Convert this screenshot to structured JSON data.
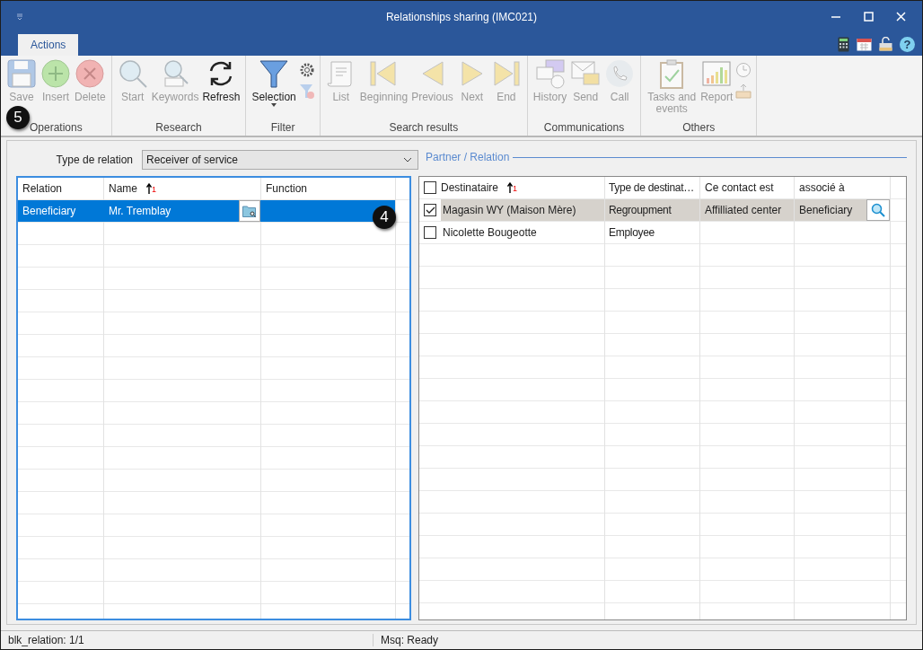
{
  "window": {
    "title": "Relationships sharing (IMC021)"
  },
  "tabs": [
    {
      "label": "Actions",
      "selected": true
    }
  ],
  "help_glyph": "?",
  "ribbon": [
    {
      "label": "Operations",
      "buttons": [
        {
          "kind": "large",
          "label": "Save",
          "disabled": true
        },
        {
          "kind": "large",
          "label": "Insert",
          "disabled": true
        },
        {
          "kind": "large",
          "label": "Delete",
          "disabled": true
        }
      ]
    },
    {
      "label": "Research",
      "buttons": [
        {
          "kind": "large",
          "label": "Start",
          "disabled": true
        },
        {
          "kind": "large",
          "label": "Keywords",
          "disabled": true
        },
        {
          "kind": "large",
          "label": "Refresh",
          "disabled": false
        }
      ]
    },
    {
      "label": "Filter",
      "buttons": [
        {
          "kind": "dropdown",
          "label": "Selection",
          "disabled": false
        },
        {
          "kind": "small",
          "disabled": false
        },
        {
          "kind": "small",
          "disabled": true
        }
      ]
    },
    {
      "label": "Search results",
      "buttons": [
        {
          "kind": "large",
          "label": "List",
          "disabled": true
        },
        {
          "kind": "large",
          "label": "Beginning",
          "disabled": true
        },
        {
          "kind": "large",
          "label": "Previous",
          "disabled": true
        },
        {
          "kind": "large",
          "label": "Next",
          "disabled": true
        },
        {
          "kind": "large",
          "label": "End",
          "disabled": true
        }
      ]
    },
    {
      "label": "Communications",
      "buttons": [
        {
          "kind": "large",
          "label": "History",
          "disabled": true
        },
        {
          "kind": "large",
          "label": "Send",
          "disabled": true
        },
        {
          "kind": "large",
          "label": "Call",
          "disabled": true
        }
      ]
    },
    {
      "label": "Others",
      "buttons": [
        {
          "kind": "large",
          "label": "Tasks and events",
          "disabled": true
        },
        {
          "kind": "large",
          "label": "Report",
          "disabled": true
        },
        {
          "kind": "small",
          "disabled": true
        },
        {
          "kind": "small",
          "disabled": true
        }
      ]
    }
  ],
  "relation_type": {
    "label": "Type de relation",
    "value": "Receiver of service"
  },
  "partner_section": {
    "title": "Partner / Relation"
  },
  "left_table": {
    "columns": [
      {
        "label": "Relation"
      },
      {
        "label": "Name",
        "sort": "1"
      },
      {
        "label": "Function"
      }
    ],
    "rows": [
      {
        "cells": [
          "Beneficiary",
          "Mr. Tremblay",
          ""
        ],
        "selected": true
      }
    ]
  },
  "right_table": {
    "header_checked": false,
    "columns": [
      {
        "label": "Destinataire",
        "sort": "1"
      },
      {
        "label": "Type de destinat…"
      },
      {
        "label": "Ce contact est"
      },
      {
        "label": "associé à"
      }
    ],
    "rows": [
      {
        "checked": true,
        "selected": true,
        "cells": [
          "Magasin WY (Maison Mère)",
          "Regroupment",
          "Affilliated center",
          "Beneficiary"
        ]
      },
      {
        "checked": false,
        "selected": false,
        "cells": [
          "Nicolette Bougeotte",
          "Employee",
          "",
          ""
        ]
      }
    ]
  },
  "status_bar": [
    "blk_relation: 1/1",
    "Msq: Ready"
  ],
  "callouts": [
    {
      "label": "5"
    },
    {
      "label": "4"
    }
  ]
}
